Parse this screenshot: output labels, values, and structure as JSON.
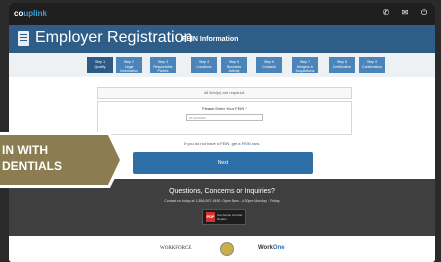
{
  "topbar": {
    "brand_a": "co",
    "brand_b": "uplink",
    "icons": [
      "phone-icon",
      "envelope-icon",
      "power-icon"
    ]
  },
  "header": {
    "title": "Employer Registration",
    "subtitle": "FEIN Information"
  },
  "steps": [
    {
      "n": "Step 1",
      "label": "Qualify"
    },
    {
      "n": "Step 2",
      "label": "Legal Information"
    },
    {
      "n": "Step 3",
      "label": "Responsible Parties"
    },
    {
      "n": "Step 4",
      "label": "Locations"
    },
    {
      "n": "Step 5",
      "label": "Business Activity"
    },
    {
      "n": "Step 6",
      "label": "Contacts"
    },
    {
      "n": "Step 7",
      "label": "Mergers & Acquisitions"
    },
    {
      "n": "Step 8",
      "label": "Certification"
    },
    {
      "n": "Step 9",
      "label": "Confirmation"
    }
  ],
  "form": {
    "required_note": "All field(s) are required.",
    "fein_label": "Please Enter Your FEIN",
    "fein_required": "*",
    "fein_placeholder": "xx-xxxxxxx",
    "no_fein_text": "If you do not have a FEIN,",
    "no_fein_link": "get a FEIN now.",
    "next_label": "Next"
  },
  "footer": {
    "title": "Questions, Concerns or Inquiries?",
    "sub": "Contact us today at 1-866-897-4490. Open 8am - 4:30pm Monday - Friday",
    "pdf_icon": "PDF",
    "pdf_label": "Get Adobe Acrobat Reader"
  },
  "logos": {
    "logo1": "WORKFORCE",
    "logo3a": "Work",
    "logo3b": "One"
  },
  "ribbon": {
    "line1": "IN WITH",
    "line2": "DENTIALS"
  },
  "colors": {
    "header": "#2e5e88",
    "step": "#4a84b9",
    "ribbon": "#8c7c52",
    "next": "#2e6fa8"
  }
}
